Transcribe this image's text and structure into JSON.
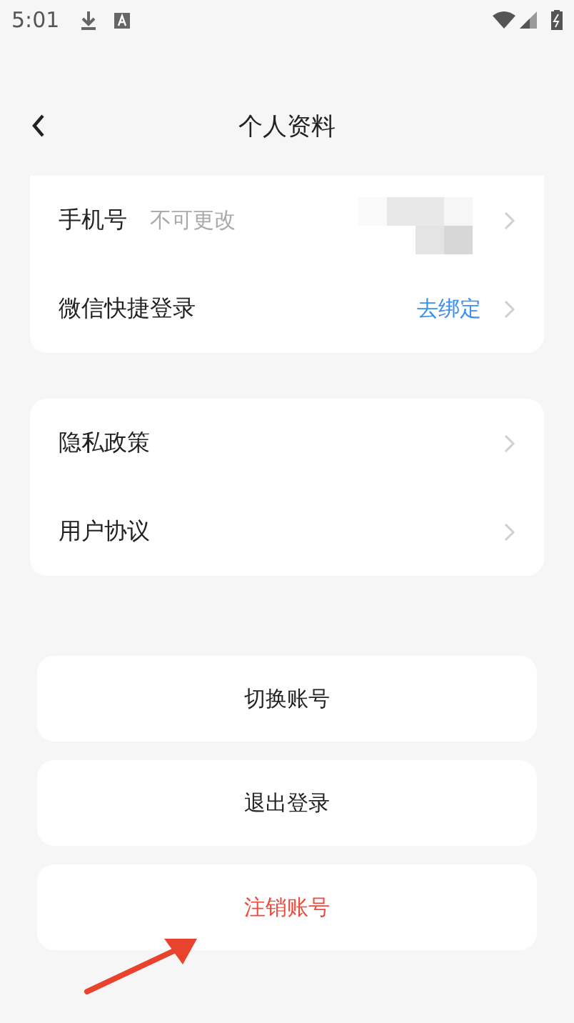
{
  "status_bar": {
    "time": "5:01"
  },
  "header": {
    "title": "个人资料"
  },
  "account_card": {
    "rows": [
      {
        "label": "手机号",
        "hint": "不可更改",
        "kind": "redacted"
      },
      {
        "label": "微信快捷登录",
        "action": "去绑定",
        "kind": "link"
      }
    ]
  },
  "policy_card": {
    "rows": [
      {
        "label": "隐私政策"
      },
      {
        "label": "用户协议"
      }
    ]
  },
  "buttons": [
    {
      "label": "切换账号",
      "kind": "normal"
    },
    {
      "label": "退出登录",
      "kind": "normal"
    },
    {
      "label": "注销账号",
      "kind": "danger"
    }
  ]
}
